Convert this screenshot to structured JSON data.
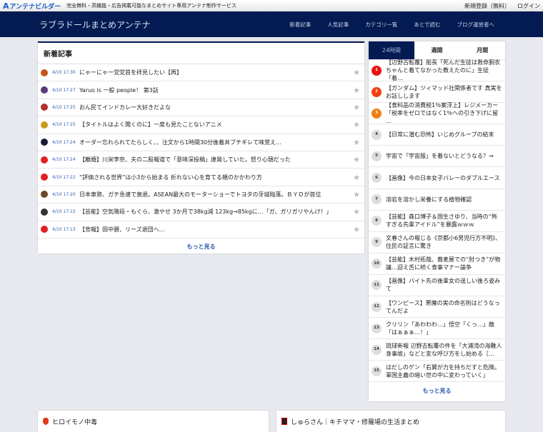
{
  "topbar": {
    "logo": "アンテナビルダー",
    "logo_mark": "A",
    "tagline": "完全無料・高機能・広告掲載可能なまとめサイト専用アンテナ制作サービス",
    "links": [
      "新規登録（無料）",
      "ログイン"
    ]
  },
  "nav": {
    "title": "ラブラドールまとめアンテナ",
    "links": [
      "新着記事",
      "人気記事",
      "カテゴリ一覧",
      "あとで読む",
      "ブログ運営者へ"
    ]
  },
  "latest": {
    "heading": "新着記事",
    "more": "もっと見る",
    "items": [
      {
        "time": "4/10 17:30",
        "title": "にゃーにゃー党党首を拝見したい【再】",
        "color": "#c8551a"
      },
      {
        "time": "4/10 17:27",
        "title": "Yaruo is 一般 people！ 第3話",
        "color": "#5a3a7a"
      },
      {
        "time": "4/10 17:25",
        "title": "おん民てインドカレー大好きだよな",
        "color": "#b0302a"
      },
      {
        "time": "4/10 17:25",
        "title": "【タイトルはよく聞くのに】一度も見たことないアニメ",
        "color": "#c89a20"
      },
      {
        "time": "4/10 17:24",
        "title": "オーダー忘れられてたらしく、、注文から1時間30分後着丼ブチギレて味覚え...",
        "color": "#1a1a3a"
      },
      {
        "time": "4/10 17:24",
        "title": "【離婚】川栄李奈、夫の二股報道で「意味深投稿」連発していた。怒り心頭だった",
        "color": "#e02020"
      },
      {
        "time": "4/10 17:22",
        "title": "“評価される世界”は小3から始まる 折れない心を育てる親のかかわり方",
        "color": "#e02020"
      },
      {
        "time": "4/10 17:20",
        "title": "日本車勢、ガチ急速で衰退。ASEAN最大のモーターショーでトヨタの牙城陥落。ＢＹＤが首位",
        "color": "#6a4a2a"
      },
      {
        "time": "4/10 17:15",
        "title": "【芸能】空気階段・もぐら、激やせ 3か月で38kg減 123kg→85kgに…「ガ、ガリガリやんけ！」",
        "color": "#333"
      },
      {
        "time": "4/10 17:13",
        "title": "【悲報】田中碧、リーズ退団へ…",
        "color": "#e02020"
      }
    ]
  },
  "ranking": {
    "tabs": [
      "24時間",
      "週間",
      "月間"
    ],
    "more": "もっと見る",
    "rank_colors": [
      "#f01010",
      "#f04010",
      "#f08010"
    ],
    "items": [
      {
        "rank": "1",
        "title": "【辺野古転覆】船長「死んだ生徒は救命胴衣ちゃんと着てなかった教えたのに」生徒「着…"
      },
      {
        "rank": "2",
        "title": "【ガンダム】ツィマッド社関係者です 真実をお話しします"
      },
      {
        "rank": "3",
        "title": "【食料品の消費税1％案浮上】レジメーカー「税率をゼロではなく1％への引き下げに留 …"
      },
      {
        "rank": "4",
        "title": "【日常に潜む恐怖】いじめグループの結末"
      },
      {
        "rank": "5",
        "title": "宇宙で「宇宙服」を着ないとどうなる？→"
      },
      {
        "rank": "6",
        "title": "【画像】今の日本女子バレーのダブルエース"
      },
      {
        "rank": "7",
        "title": "溶岩を溶かし栄養にする植物確認"
      },
      {
        "rank": "8",
        "title": "【芸能】森口博子＆国生さゆり、当時の“怖すぎる先輩アイドル”を暴露ｗｗｗ"
      },
      {
        "rank": "9",
        "title": "文春さんの報じる《京都小6男児行方不明》、住民の証言に驚き"
      },
      {
        "rank": "10",
        "title": "【芸能】木村拓哉、蕎麦屋での“肘つき”が物議…迎え舌に続く食事マナー論争"
      },
      {
        "rank": "11",
        "title": "【画像】バイト先の後輩女の逞しい後ろ姿みて"
      },
      {
        "rank": "12",
        "title": "【ワンピース】悪魔の実の命名則はどうなってんだよ"
      },
      {
        "rank": "13",
        "title": "クリリン「あわわわ…」悟空「くっ…」敵「はぁぁぁ…！」"
      },
      {
        "rank": "14",
        "title": "琉球新報 辺野古転覆の件を「大浦湾の海難人身事故」などと変な呼び方をし始める［…"
      },
      {
        "rank": "15",
        "title": "はだしのゲン「右翼が力を持ちだすと危険。軍国主義の暗い世の中に変わっていく」"
      }
    ]
  },
  "blogs": [
    "ヒロイモノ中毒",
    "しゅらさん｜キチママ・修羅場の生活まとめ"
  ]
}
